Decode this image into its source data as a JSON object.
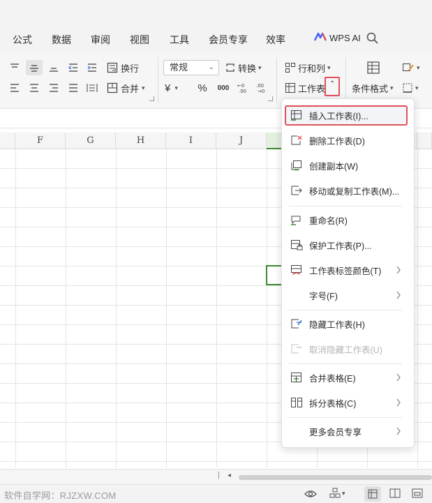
{
  "menubar": {
    "tabs": [
      "公式",
      "数据",
      "审阅",
      "视图",
      "工具",
      "会员专享",
      "效率"
    ],
    "wps_ai_label": "WPS AI"
  },
  "ribbon": {
    "wrap_label": "换行",
    "merge_label": "合并",
    "number_format": "常规",
    "convert_label": "转换",
    "currency_symbol": "¥",
    "percent_symbol": "%",
    "thousands_symbol": "000",
    "rows_cols_label": "行和列",
    "worksheet_label": "工作表",
    "conditional_format_label": "条件格式"
  },
  "columns": [
    "F",
    "G",
    "H",
    "I",
    "J"
  ],
  "dropdown": {
    "items": [
      {
        "label": "插入工作表(I)...",
        "icon": "insert-sheet-icon",
        "submenu": false,
        "disabled": false
      },
      {
        "label": "删除工作表(D)",
        "icon": "delete-sheet-icon",
        "submenu": false,
        "disabled": false
      },
      {
        "label": "创建副本(W)",
        "icon": "copy-sheet-icon",
        "submenu": false,
        "disabled": false
      },
      {
        "label": "移动或复制工作表(M)...",
        "icon": "move-sheet-icon",
        "submenu": false,
        "disabled": false
      },
      {
        "label": "重命名(R)",
        "icon": "rename-icon",
        "submenu": false,
        "disabled": false
      },
      {
        "label": "保护工作表(P)...",
        "icon": "protect-sheet-icon",
        "submenu": false,
        "disabled": false
      },
      {
        "label": "工作表标签颜色(T)",
        "icon": "tab-color-icon",
        "submenu": true,
        "disabled": false
      },
      {
        "label": "字号(F)",
        "icon": "",
        "submenu": true,
        "disabled": false
      },
      {
        "label": "隐藏工作表(H)",
        "icon": "hide-sheet-icon",
        "submenu": false,
        "disabled": false
      },
      {
        "label": "取消隐藏工作表(U)",
        "icon": "unhide-sheet-icon",
        "submenu": false,
        "disabled": true
      },
      {
        "label": "合并表格(E)",
        "icon": "merge-tables-icon",
        "submenu": true,
        "disabled": false
      },
      {
        "label": "拆分表格(C)",
        "icon": "split-table-icon",
        "submenu": true,
        "disabled": false
      },
      {
        "label": "更多会员专享",
        "icon": "",
        "submenu": true,
        "disabled": false
      }
    ]
  },
  "statusbar": {
    "watermark": "软件自学网：RJZXW.COM"
  },
  "colors": {
    "accent_green": "#3a8a2e",
    "highlight_red": "#e0505a",
    "wps_blue": "#3d5afe"
  }
}
